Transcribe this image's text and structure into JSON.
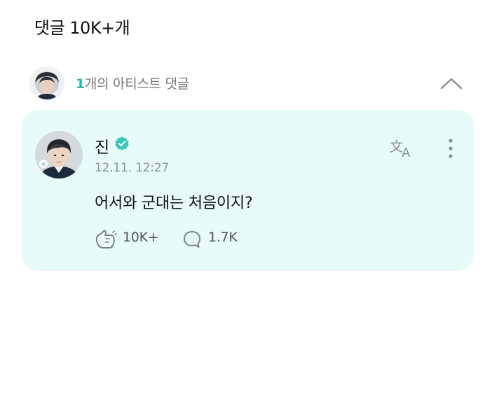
{
  "header": {
    "title": "댓글 10K+개"
  },
  "artist_section": {
    "count": "1",
    "label": "개의 아티스트 댓글",
    "chevron_icon": "chevron-up-icon"
  },
  "comment": {
    "author": "진",
    "verified_icon": "verified-badge-icon",
    "timestamp": "12.11. 12:27",
    "text": "어서와 군대는 처음이지?",
    "translate_icon": "translate-icon",
    "more_icon": "more-vertical-icon",
    "likes": "10K+",
    "like_icon": "like-hand-icon",
    "replies": "1.7K",
    "reply_icon": "speech-bubble-icon"
  },
  "colors": {
    "card_background": "#e7fcf9",
    "accent": "#1fb9b0",
    "verified_badge": "#38c6bb"
  }
}
